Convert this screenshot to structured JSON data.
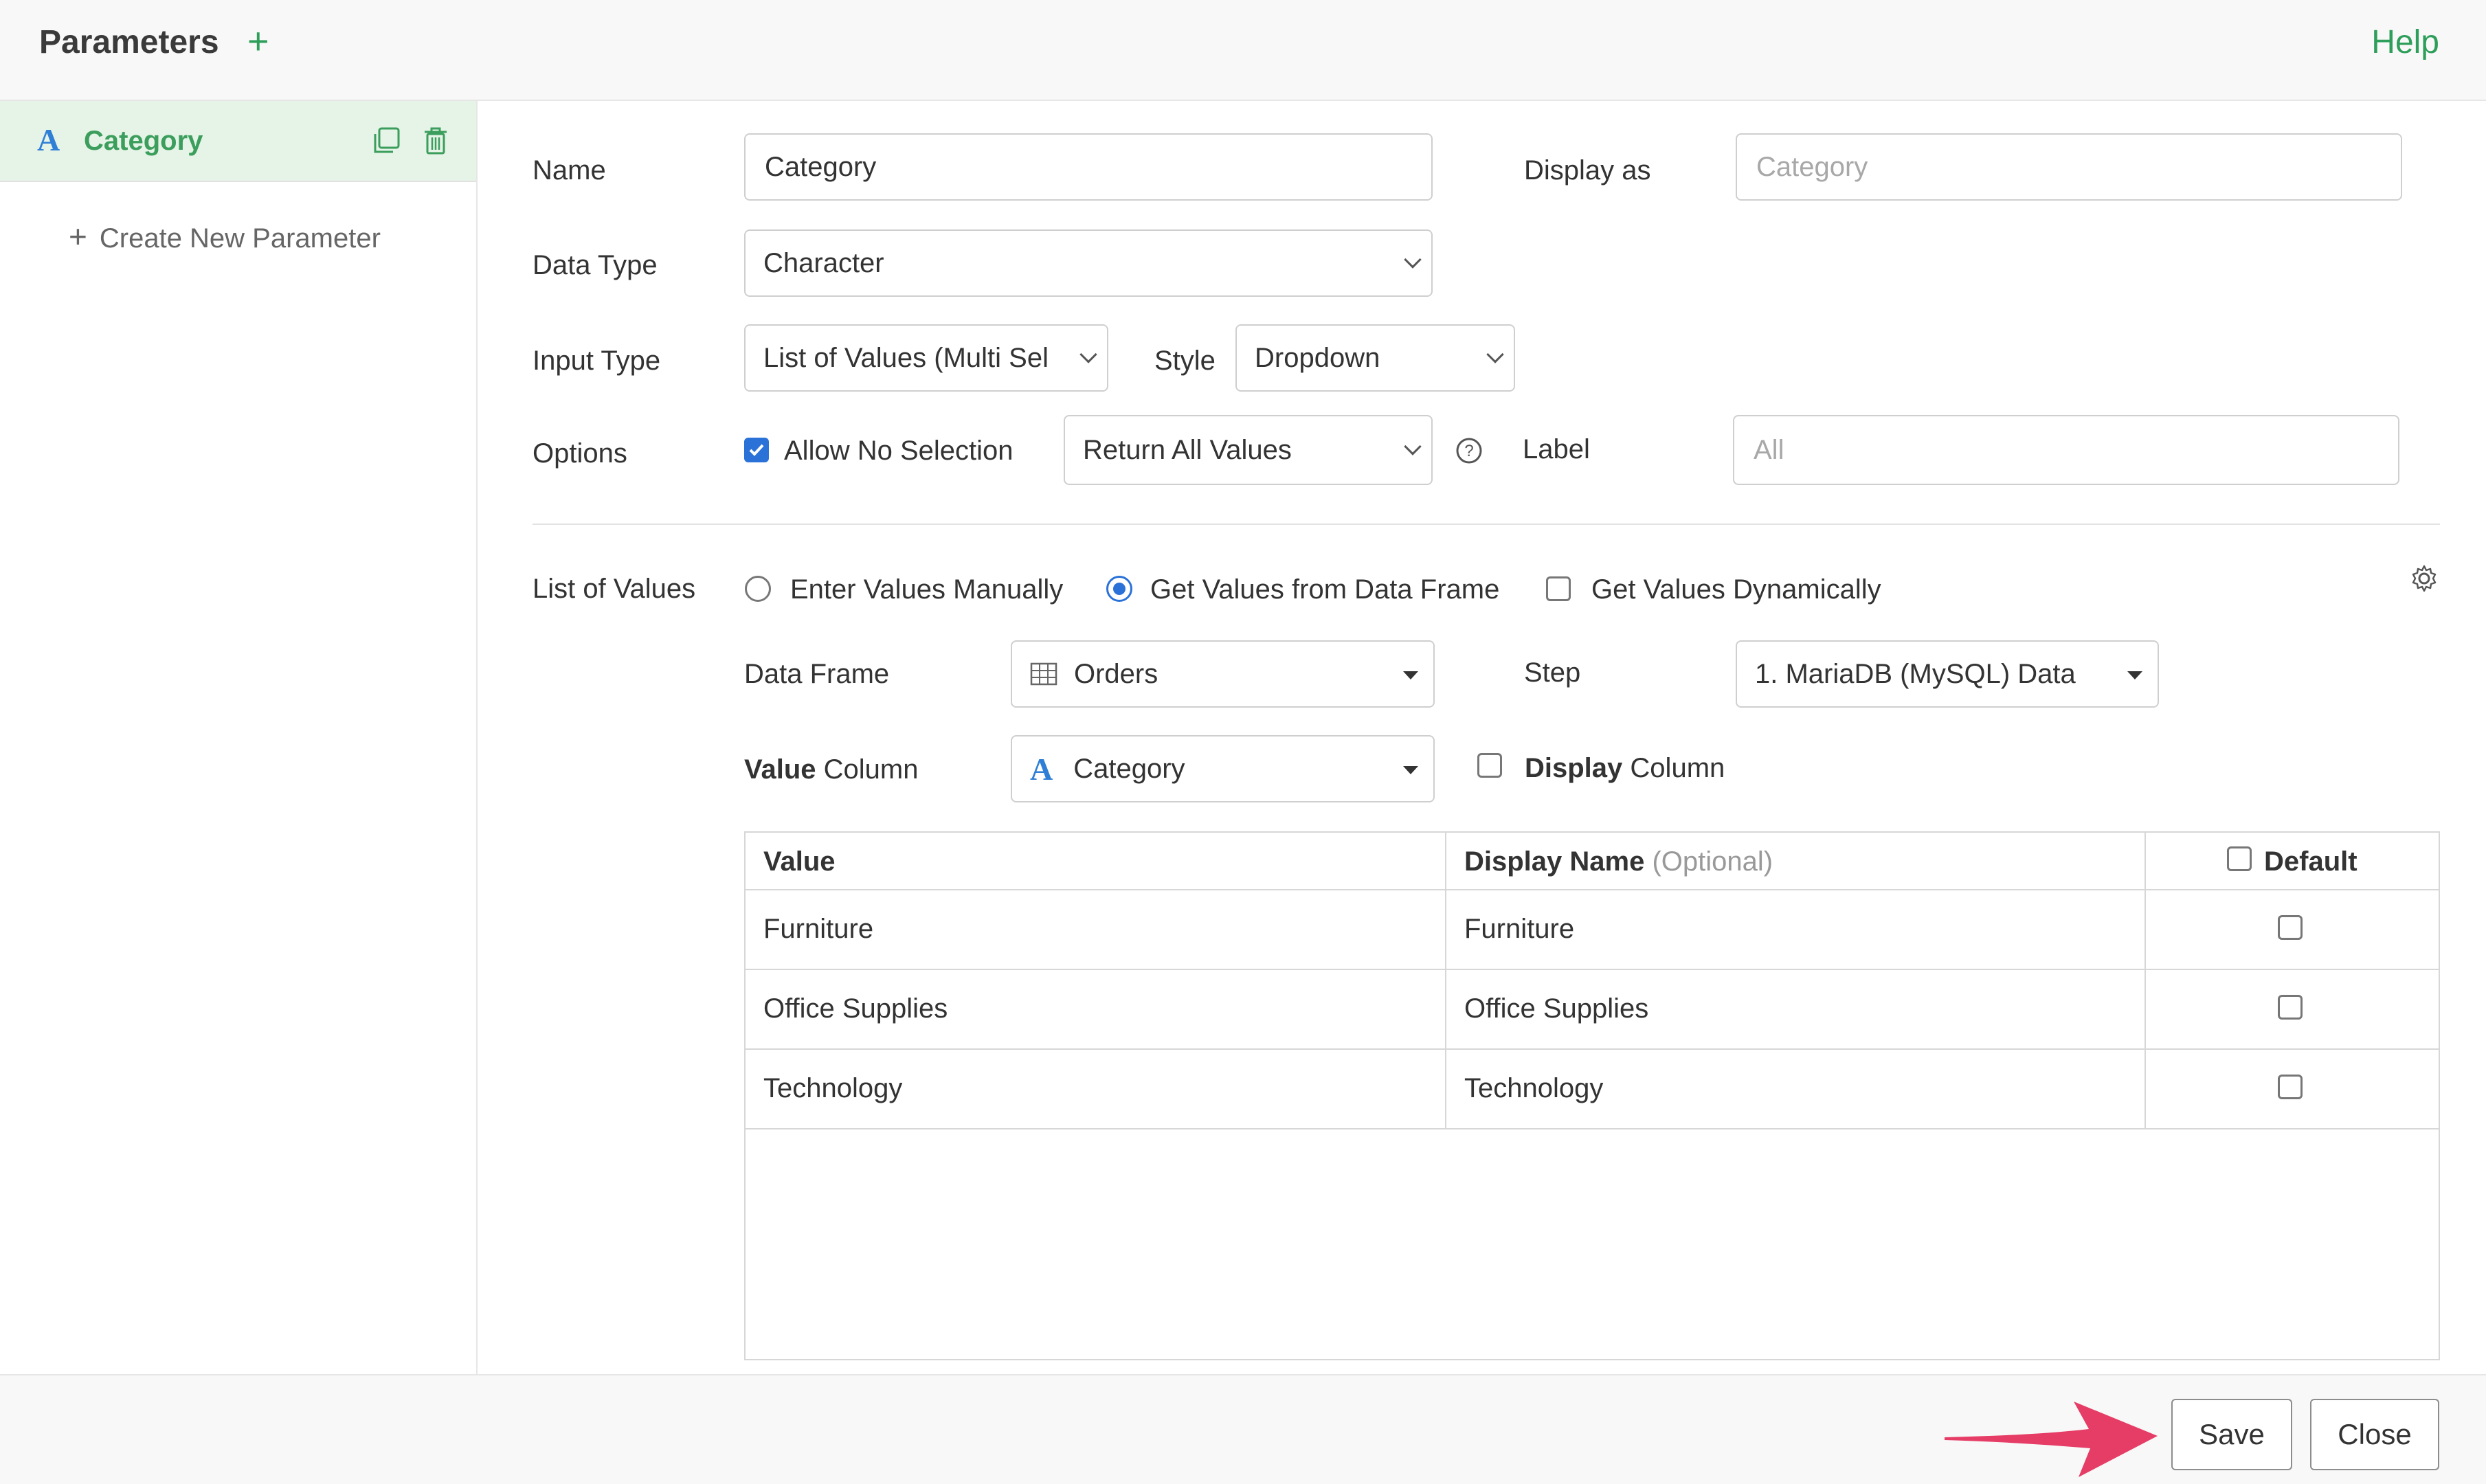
{
  "header": {
    "title": "Parameters",
    "help": "Help"
  },
  "sidebar": {
    "items": [
      {
        "type_glyph": "A",
        "label": "Category"
      }
    ],
    "create_new": "Create New Parameter"
  },
  "form": {
    "name_label": "Name",
    "name_value": "Category",
    "display_as_label": "Display as",
    "display_as_placeholder": "Category",
    "data_type_label": "Data Type",
    "data_type_value": "Character",
    "input_type_label": "Input Type",
    "input_type_value": "List of Values (Multi Sel",
    "style_label": "Style",
    "style_value": "Dropdown",
    "options_label": "Options",
    "allow_no_selection": {
      "label": "Allow No Selection",
      "checked": true
    },
    "no_selection_behavior": "Return All Values",
    "label_label": "Label",
    "label_placeholder": "All"
  },
  "list_of_values": {
    "label": "List of Values",
    "sources": [
      {
        "label": "Enter Values Manually",
        "selected": false
      },
      {
        "label": "Get Values from Data Frame",
        "selected": true
      }
    ],
    "dynamic": {
      "label": "Get Values Dynamically",
      "checked": false
    },
    "data_frame_label": "Data Frame",
    "data_frame_value": "Orders",
    "step_label": "Step",
    "step_value": "1. MariaDB (MySQL) Data",
    "value_column_bold": "Value",
    "value_column_rest": "Column",
    "value_column_type_glyph": "A",
    "value_column_value": "Category",
    "display_column_bold": "Display",
    "display_column_rest": "Column",
    "display_column_checked": false
  },
  "table": {
    "headers": {
      "value": "Value",
      "display_name": "Display Name",
      "display_name_hint": "(Optional)",
      "default": "Default"
    },
    "rows": [
      {
        "value": "Furniture",
        "display": "Furniture",
        "default": false
      },
      {
        "value": "Office Supplies",
        "display": "Office Supplies",
        "default": false
      },
      {
        "value": "Technology",
        "display": "Technology",
        "default": false
      }
    ]
  },
  "footer": {
    "save": "Save",
    "close": "Close"
  },
  "colors": {
    "accent_green": "#2e9e5b",
    "accent_blue": "#2a72d8",
    "arrow": "#e63d66",
    "selected_bg": "#e6f3e7"
  }
}
